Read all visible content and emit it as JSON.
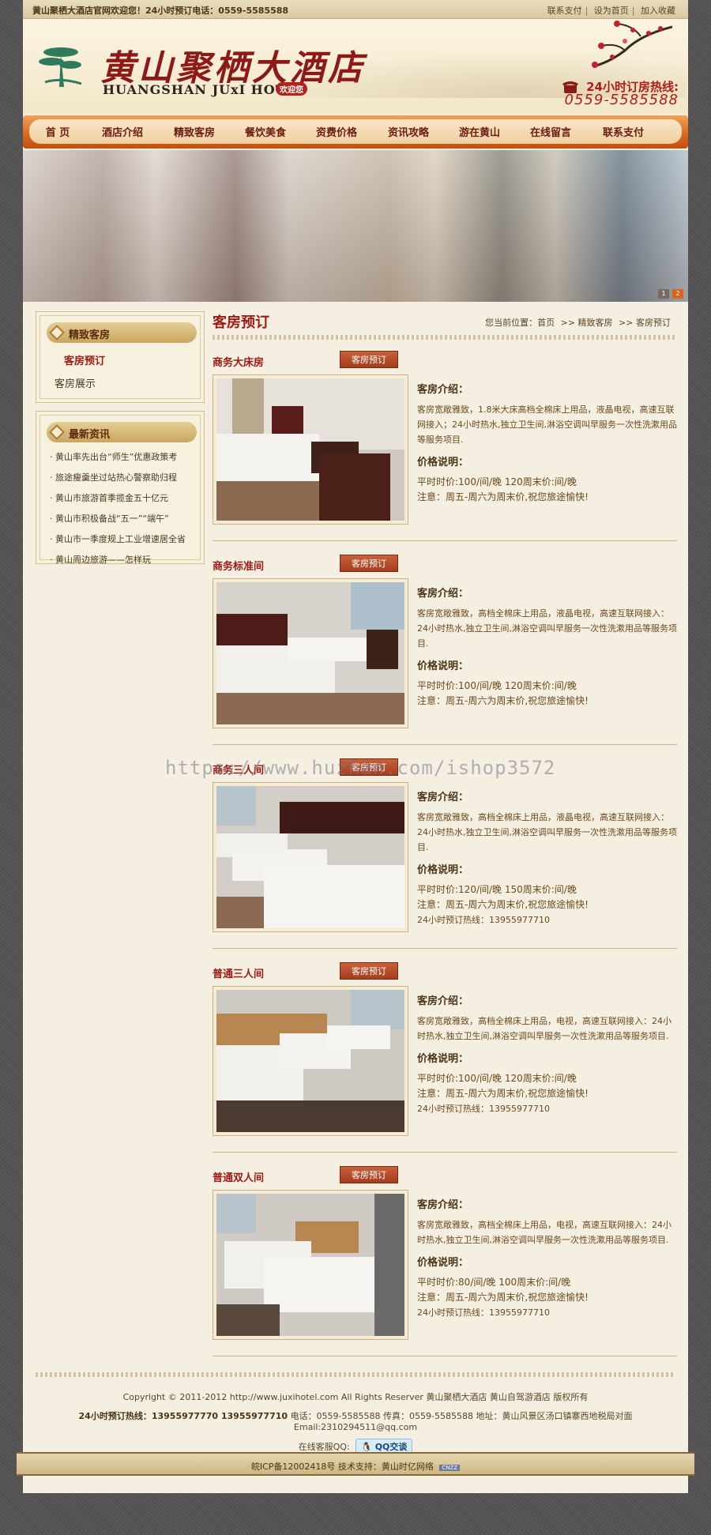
{
  "topbar": {
    "welcome": "黄山聚栖大酒店官网欢迎您！24小时预订电话：0559-5585588",
    "links": [
      "联系支付",
      "设为首页",
      "加入收藏"
    ]
  },
  "header": {
    "logo_cn": "黄山聚栖大酒店",
    "logo_en": "HUANGSHAN JUxI HOTEL",
    "logo_badge": "欢迎您",
    "hotline_label": "24小时订房热线:",
    "hotline_number": "0559-5585588"
  },
  "nav": [
    "首  页",
    "酒店介绍",
    "精致客房",
    "餐饮美食",
    "资费价格",
    "资讯攻略",
    "游在黄山",
    "在线留言",
    "联系支付"
  ],
  "banner": {
    "pages": [
      "1",
      "2"
    ]
  },
  "sidebar": {
    "rooms_title": "精致客房",
    "rooms_links": [
      "客房预订",
      "客房展示"
    ],
    "news_title": "最新资讯",
    "news": [
      "· 黄山率先出台“师生”优惠政策考",
      "· 旅途瘦羹坐过站热心警察助归程",
      "· 黄山市旅游首季揽金五十亿元",
      "· 黄山市积极备战“五一”“端午”",
      "· 黄山市一季度规上工业增速居全省",
      "· 黄山周边旅游——怎样玩"
    ]
  },
  "main": {
    "title": "客房预订",
    "breadcrumb": [
      "您当前位置：首页",
      ">> 精致客房",
      ">> 客房预订"
    ],
    "book_label": "客房预订",
    "intro_heading": "客房介绍：",
    "price_heading": "价格说明：",
    "rooms": [
      {
        "name": "商务大床房",
        "desc": "客房宽敞雅致，1.8米大床高档全棉床上用品，液晶电视，高速互联网接入；24小时热水,独立卫生间,淋浴空调叫早服务一次性洗漱用品等服务项目.",
        "price_lines": [
          "平时时价:100/间/晚  120周末价:间/晚",
          "注意：周五-周六为周末价,祝您旅途愉快!"
        ]
      },
      {
        "name": "商务标准间",
        "desc": "客房宽敞雅致，高档全棉床上用品，液晶电视，高速互联网接入：24小时热水,独立卫生间,淋浴空调叫早服务一次性洗漱用品等服务项目.",
        "price_lines": [
          "平时时价:100/间/晚  120周末价:间/晚",
          "注意：周五-周六为周末价,祝您旅途愉快!"
        ]
      },
      {
        "name": "商务三人间",
        "desc": "客房宽敞雅致，高档全棉床上用品，液晶电视，高速互联网接入：24小时热水,独立卫生间,淋浴空调叫早服务一次性洗漱用品等服务项目.",
        "price_lines": [
          "平时时价:120/间/晚  150周末价:间/晚",
          "注意：周五-周六为周末价,祝您旅途愉快!",
          "24小时预订热线：13955977710"
        ]
      },
      {
        "name": "普通三人间",
        "desc": "客房宽敞雅致，高档全棉床上用品，电视，高速互联网接入：24小时热水,独立卫生间,淋浴空调叫早服务一次性洗漱用品等服务项目.",
        "price_lines": [
          "平时时价:100/间/晚  120周末价:间/晚",
          "注意：周五-周六为周末价,祝您旅途愉快!",
          "24小时预订热线：13955977710"
        ]
      },
      {
        "name": "普通双人间",
        "desc": "客房宽敞雅致，高档全棉床上用品，电视，高速互联网接入：24小时热水,独立卫生间,淋浴空调叫早服务一次性洗漱用品等服务项目.",
        "price_lines": [
          "平时时价:80/间/晚  100周末价:间/晚",
          "注意：周五-周六为周末价,祝您旅途愉快!",
          "24小时预订热线：13955977710"
        ]
      }
    ]
  },
  "watermark": "https://www.huzhan.com/ishop3572",
  "footer": {
    "copyright": "Copyright © 2011-2012 http://www.juxihotel.com All Rights Reserver 黄山聚栖大酒店 黄山自驾游酒店  版权所有",
    "hotline": "24小时预订热线：13955977770 13955977710",
    "contact": "电话：0559-5585588  传真：0559-5585588  地址：黄山风景区汤口镇寨西地税局对面  Email:2310294511@qq.com",
    "qq_label": "在线客服QQ:",
    "qq_button": "QQ交谈",
    "icp": "皖ICP备12002418号  技术支持：黄山时亿网络",
    "stat": "CNZZ"
  }
}
